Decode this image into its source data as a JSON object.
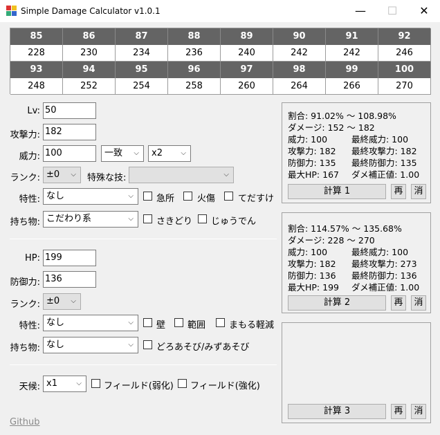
{
  "window": {
    "title": "Simple Damage Calculator v1.0.1",
    "minimize": "—",
    "maximize": "☐",
    "close": "✕"
  },
  "table": {
    "row1_levels": [
      "85",
      "86",
      "87",
      "88",
      "89",
      "90",
      "91",
      "92"
    ],
    "row1_values": [
      "228",
      "230",
      "234",
      "236",
      "240",
      "242",
      "242",
      "246"
    ],
    "row2_levels": [
      "93",
      "94",
      "95",
      "96",
      "97",
      "98",
      "99",
      "100"
    ],
    "row2_values": [
      "248",
      "252",
      "254",
      "258",
      "260",
      "264",
      "266",
      "270"
    ]
  },
  "attacker": {
    "lv_label": "Lv:",
    "lv_value": "50",
    "atk_label": "攻撃力:",
    "atk_value": "182",
    "power_label": "威力:",
    "power_value": "100",
    "stab_value": "一致",
    "mult_value": "x2",
    "rank_label": "ランク:",
    "rank_value": "±0",
    "special_label": "特殊な技:",
    "special_value": "",
    "ability_label": "特性:",
    "ability_value": "なし",
    "crit_label": "急所",
    "burn_label": "火傷",
    "helping_label": "てだすけ",
    "item_label": "持ち物:",
    "item_value": "こだわり系",
    "lead_label": "さきどり",
    "charge_label": "じゅうでん"
  },
  "defender": {
    "hp_label": "HP:",
    "hp_value": "199",
    "def_label": "防御力:",
    "def_value": "136",
    "rank_label": "ランク:",
    "rank_value": "±0",
    "ability_label": "特性:",
    "ability_value": "なし",
    "wall_label": "壁",
    "spread_label": "範囲",
    "multiscale_label": "まもる軽減",
    "item_label": "持ち物:",
    "item_value": "なし",
    "sport_label": "どろあそび/みずあそび"
  },
  "env": {
    "weather_label": "天候:",
    "weather_value": "x1",
    "field_weak_label": "フィールド(弱化)",
    "field_strong_label": "フィールド(強化)"
  },
  "results": [
    {
      "ratio": "割合: 91.02% ～ 108.98%",
      "damage": "ダメージ: 152 ～ 182",
      "l1": "威力: 100",
      "r1": "最終威力: 100",
      "l2": "攻撃力: 182",
      "r2": "最終攻撃力: 182",
      "l3": "防御力: 135",
      "r3": "最終防御力: 135",
      "l4": "最大HP: 167",
      "r4": "ダメ補正値: 1.00",
      "calc": "計算 1",
      "redo": "再",
      "clear": "消"
    },
    {
      "ratio": "割合: 114.57% ～ 135.68%",
      "damage": "ダメージ: 228 ～ 270",
      "l1": "威力: 100",
      "r1": "最終威力: 100",
      "l2": "攻撃力: 182",
      "r2": "最終攻撃力: 273",
      "l3": "防御力: 136",
      "r3": "最終防御力: 136",
      "l4": "最大HP: 199",
      "r4": "ダメ補正値: 1.00",
      "calc": "計算 2",
      "redo": "再",
      "clear": "消"
    },
    {
      "calc": "計算 3",
      "redo": "再",
      "clear": "消"
    }
  ],
  "footer": {
    "github": "Github"
  },
  "colors": {
    "header_cell": "#646464",
    "link": "#8a8a8a"
  }
}
